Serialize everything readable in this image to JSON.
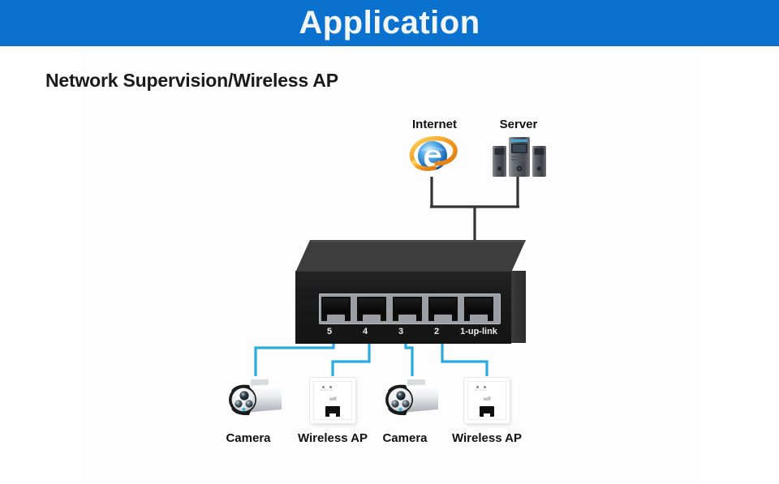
{
  "header": {
    "title": "Application",
    "band_color": "#0a72ce",
    "title_color": "#f2f6fa"
  },
  "section": {
    "title": "Network Supervision/Wireless AP"
  },
  "colors": {
    "link_blue": "#29abe2",
    "link_black": "#333333",
    "switch_body": "#1b1b1b",
    "switch_top": "#3d3d3d",
    "port_tray": "#9b9fa3"
  },
  "diagram": {
    "type": "network-topology",
    "uplink_nodes": [
      {
        "id": "internet",
        "label": "Internet",
        "icon": "internet-explorer-icon"
      },
      {
        "id": "server",
        "label": "Server",
        "icon": "server-tower-icon"
      }
    ],
    "device": {
      "name": "ethernet-switch",
      "ports": [
        {
          "label": "5",
          "connects_to": "camera-1"
        },
        {
          "label": "4",
          "connects_to": "wireless-ap-1"
        },
        {
          "label": "3",
          "connects_to": "camera-2"
        },
        {
          "label": "2",
          "connects_to": "wireless-ap-2"
        },
        {
          "label": "1-up-link",
          "connects_to": "internet-and-server"
        }
      ]
    },
    "edge_nodes": [
      {
        "id": "camera-1",
        "label": "Camera",
        "icon": "bullet-ip-camera-icon"
      },
      {
        "id": "wireless-ap-1",
        "label": "Wireless AP",
        "icon": "wall-wireless-ap-icon",
        "plate_text": "wifi"
      },
      {
        "id": "camera-2",
        "label": "Camera",
        "icon": "bullet-ip-camera-icon"
      },
      {
        "id": "wireless-ap-2",
        "label": "Wireless AP",
        "icon": "wall-wireless-ap-icon",
        "plate_text": "wifi"
      }
    ]
  }
}
